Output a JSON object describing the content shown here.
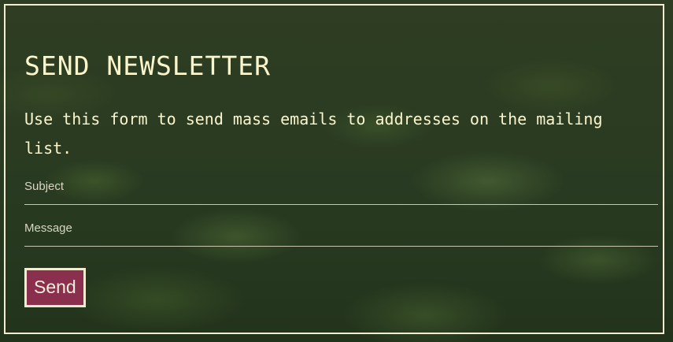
{
  "newsletter": {
    "title": "SEND NEWSLETTER",
    "description": "Use this form to send mass emails to addresses on the mailing list.",
    "fields": {
      "subject": {
        "label": "Subject",
        "value": ""
      },
      "message": {
        "label": "Message",
        "value": ""
      }
    },
    "send_label": "Send"
  },
  "colors": {
    "text": "#fbf5cc",
    "border": "#f2ecd0",
    "button": "#8a2f4e",
    "background": "#2c3a1e"
  },
  "background": {
    "description": "green tea leaves"
  }
}
